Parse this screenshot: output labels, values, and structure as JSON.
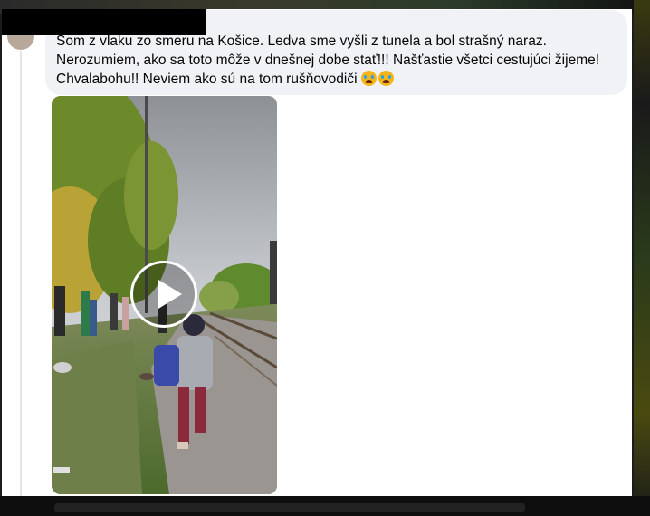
{
  "post": {
    "message_lines": [
      "Som z vlaku zo smeru na Košice. Ledva sme vyšli z tunela a bol strašný naraz.",
      "Nerozumiem, ako sa toto môže v dnešnej dobe stať!!! Našťastie všetci cestujúci žijeme!",
      "Chvalabohu!! Neviem ako sú na tom rušňovodiči"
    ],
    "emojis": [
      "crying-face-emoji",
      "crying-face-emoji"
    ]
  },
  "video": {
    "play_icon": "play-icon"
  },
  "colors": {
    "bubble_bg": "#f0f2f5",
    "text": "#050505",
    "redaction": "#000000"
  }
}
